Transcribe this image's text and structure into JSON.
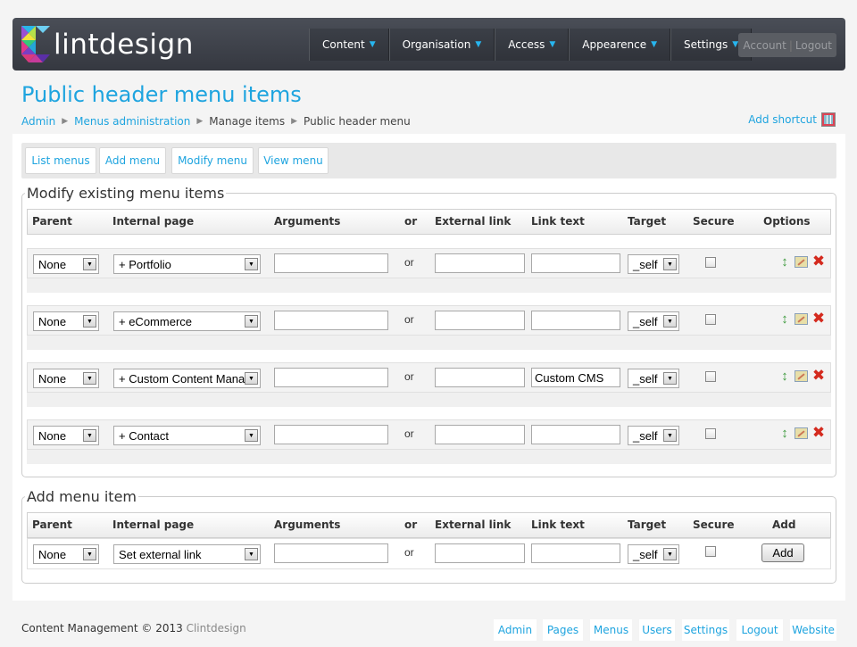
{
  "brand": {
    "name": "lintdesign"
  },
  "nav": [
    {
      "label": "Content"
    },
    {
      "label": "Organisation"
    },
    {
      "label": "Access"
    },
    {
      "label": "Appearence"
    },
    {
      "label": "Settings"
    }
  ],
  "account": {
    "account": "Account",
    "sep": "|",
    "logout": "Logout"
  },
  "page_title": "Public header menu items",
  "breadcrumb": [
    "Admin",
    "Menus administration",
    "Manage items",
    "Public header menu"
  ],
  "shortcut": "Add shortcut",
  "tabs": [
    "List menus",
    "Add menu",
    "Modify menu",
    "View menu"
  ],
  "existing": {
    "legend": "Modify existing menu items",
    "headers": [
      "Parent",
      "Internal page",
      "Arguments",
      "or",
      "External link",
      "Link text",
      "Target",
      "Secure",
      "Options"
    ],
    "rows": [
      {
        "parent": "None",
        "page": "+ Portfolio",
        "args": "",
        "or": "or",
        "ext": "",
        "text": "",
        "target": "_self"
      },
      {
        "parent": "None",
        "page": "+ eCommerce",
        "args": "",
        "or": "or",
        "ext": "",
        "text": "",
        "target": "_self"
      },
      {
        "parent": "None",
        "page": "+ Custom Content Mana",
        "args": "",
        "or": "or",
        "ext": "",
        "text": "Custom CMS",
        "target": "_self"
      },
      {
        "parent": "None",
        "page": "+ Contact",
        "args": "",
        "or": "or",
        "ext": "",
        "text": "",
        "target": "_self"
      }
    ]
  },
  "add": {
    "legend": "Add menu item",
    "headers": [
      "Parent",
      "Internal page",
      "Arguments",
      "or",
      "External link",
      "Link text",
      "Target",
      "Secure",
      "Add"
    ],
    "row": {
      "parent": "None",
      "page": "Set external link",
      "or": "or",
      "target": "_self",
      "button": "Add"
    }
  },
  "footer": {
    "text": "Content Management © 2013",
    "brand": "Clintdesign",
    "links": [
      "Admin",
      "Pages",
      "Menus",
      "Users",
      "Settings",
      "Logout",
      "Website"
    ]
  },
  "colors": {
    "accent": "#1ea4df",
    "topbar": "#3c3f47"
  }
}
